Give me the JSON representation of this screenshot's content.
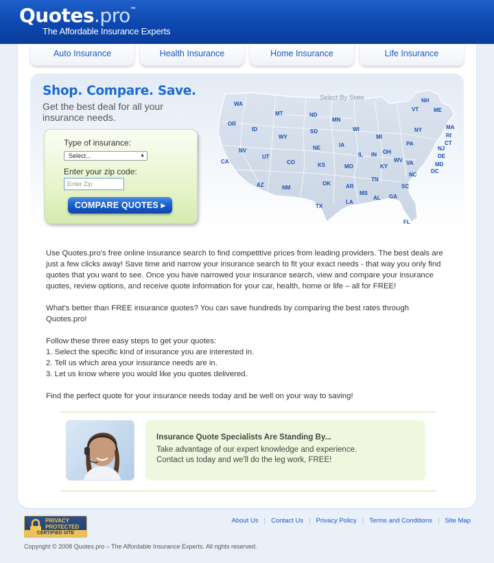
{
  "brand": {
    "name": "Quotes",
    "ext": ".pro",
    "tm": "™",
    "tagline": "The Affordable Insurance Experts"
  },
  "tabs": [
    "Auto Insurance",
    "Health Insurance",
    "Home Insurance",
    "Life Insurance"
  ],
  "hero": {
    "title": "Shop. Compare. Save.",
    "subtitle": "Get the best deal for all your insurance needs.",
    "map_heading": "Select By State",
    "states": [
      "WA",
      "MT",
      "ND",
      "MN",
      "OR",
      "ID",
      "SD",
      "WI",
      "MI",
      "NY",
      "VT",
      "NH",
      "ME",
      "MA",
      "RI",
      "CT",
      "NJ",
      "DE",
      "MD",
      "DC",
      "WY",
      "NE",
      "IA",
      "IL",
      "IN",
      "OH",
      "PA",
      "WV",
      "VA",
      "NV",
      "UT",
      "CO",
      "KS",
      "MO",
      "KY",
      "CA",
      "AZ",
      "NM",
      "OK",
      "AR",
      "TN",
      "NC",
      "SC",
      "TX",
      "LA",
      "MS",
      "AL",
      "GA",
      "FL"
    ]
  },
  "form": {
    "type_label": "Type of insurance:",
    "type_value": "Select...",
    "zip_label": "Enter your zip code:",
    "zip_placeholder": "Enter Zip",
    "button": "COMPARE QUOTES"
  },
  "body": {
    "p1": "Use Quotes.pro's free online insurance search to find competitive prices from leading providers. The best deals are just a few clicks away! Save time and narrow your insurance search to fit your exact needs - that way you only find quotes that you want to see. Once you have narrowed your insurance search, view and compare your insurance quotes, review options, and receive quote information for your car, health, home or life – all for FREE!",
    "p2": "What's better than FREE insurance quotes? You can save hundreds by comparing the best rates through Quotes.pro!",
    "steps_intro": "Follow these three easy steps to get your quotes:",
    "steps": [
      "1. Select the specific kind of insurance you are interested in.",
      "2. Tell us which area your insurance needs are in.",
      "3. Let us know where you would like you quotes delivered."
    ],
    "p3": "Find the perfect quote for your insurance needs today and be well on your way to saving!"
  },
  "specialists": {
    "heading": "Insurance Quote Specialists Are Standing By...",
    "line1": "Take advantage of our expert knowledge and experience.",
    "line2": "Contact us today and we'll do the leg work, FREE!"
  },
  "badge": {
    "line1": "PRIVACY",
    "line2": "PROTECTED",
    "line3": "CERTIFIED SITE"
  },
  "footer": {
    "links": [
      "About Us",
      "Contact Us",
      "Privacy Policy",
      "Terms and Conditions",
      "Site Map"
    ],
    "copyright": "Copyright © 2008 Quotes.pro – The Affordable Insurance Experts. All rights reserved."
  },
  "colors": {
    "header": "#0d47b0",
    "link": "#1a57c7",
    "title": "#1a6bd2",
    "green_panel": "#eff8de"
  }
}
